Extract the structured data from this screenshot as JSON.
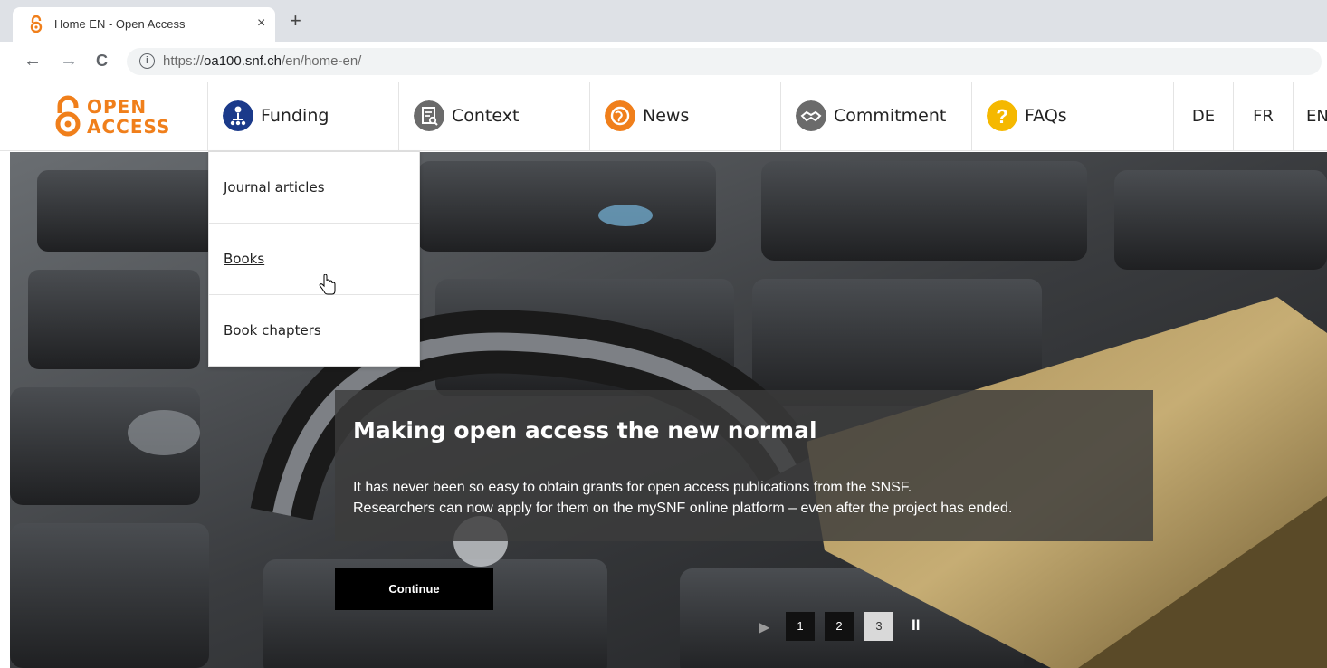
{
  "browser": {
    "tab_title": "Home EN - Open Access",
    "tab_close": "×",
    "new_tab": "+",
    "back": "←",
    "forward": "→",
    "reload": "C",
    "info": "i",
    "url_prefix": "https://",
    "url_host": "oa100.snf.ch",
    "url_path": "/en/home-en/"
  },
  "site": {
    "logo_line1": "OPEN",
    "logo_line2": "ACCESS",
    "logo_color": "#f07f1b",
    "nav": [
      {
        "label": "Funding",
        "icon": "funding-icon",
        "color": "#1b3a8a"
      },
      {
        "label": "Context",
        "icon": "context-icon",
        "color": "#6b6b6b"
      },
      {
        "label": "News",
        "icon": "news-icon",
        "color": "#f07f1b"
      },
      {
        "label": "Commitment",
        "icon": "commitment-icon",
        "color": "#6b6b6b"
      },
      {
        "label": "FAQs",
        "icon": "faqs-icon",
        "color": "#f5b800"
      }
    ],
    "faq_glyph": "?",
    "languages": [
      "DE",
      "FR",
      "EN"
    ]
  },
  "dropdown": {
    "items": [
      "Journal articles",
      "Books",
      "Book chapters"
    ],
    "hovered": "Books"
  },
  "hero": {
    "title": "Making open access the new normal",
    "text_line1": "It has never been so easy to obtain grants for open access publications from the SNSF.",
    "text_line2": "Researchers can now apply for them on the mySNF online platform – even after the project has ended.",
    "button": "Continue",
    "pages": [
      "1",
      "2",
      "3"
    ],
    "active_page": "3",
    "play_glyph": "▶",
    "pause_glyph": "II"
  }
}
